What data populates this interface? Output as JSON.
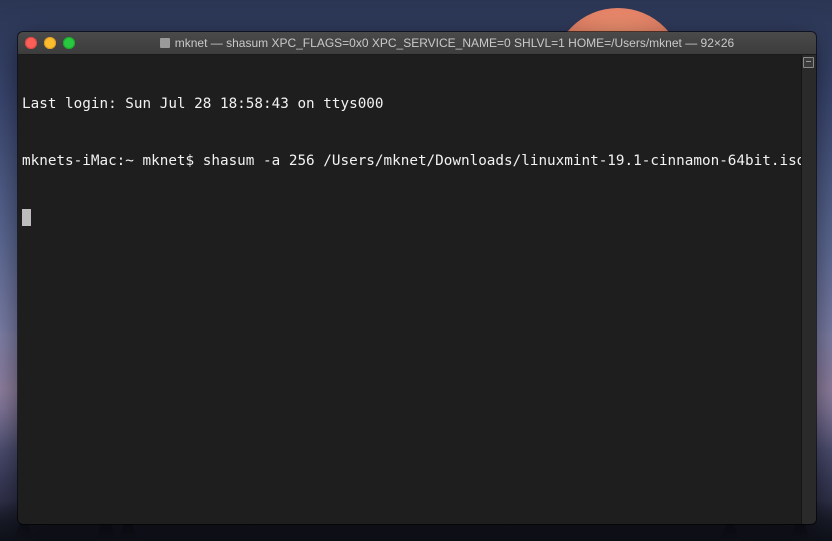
{
  "window": {
    "title": "mknet — shasum XPC_FLAGS=0x0 XPC_SERVICE_NAME=0 SHLVL=1 HOME=/Users/mknet — 92×26"
  },
  "terminal": {
    "lines": [
      "Last login: Sun Jul 28 18:58:43 on ttys000",
      "mknets-iMac:~ mknet$ shasum -a 256 /Users/mknet/Downloads/linuxmint-19.1-cinnamon-64bit.iso"
    ]
  },
  "colors": {
    "terminal_bg": "#1e1e1e",
    "terminal_fg": "#f2f2f2",
    "close": "#fc5f57",
    "minimize": "#fdbc2e",
    "zoom": "#28c840"
  },
  "icons": {
    "title_icon": "home-folder-icon"
  }
}
